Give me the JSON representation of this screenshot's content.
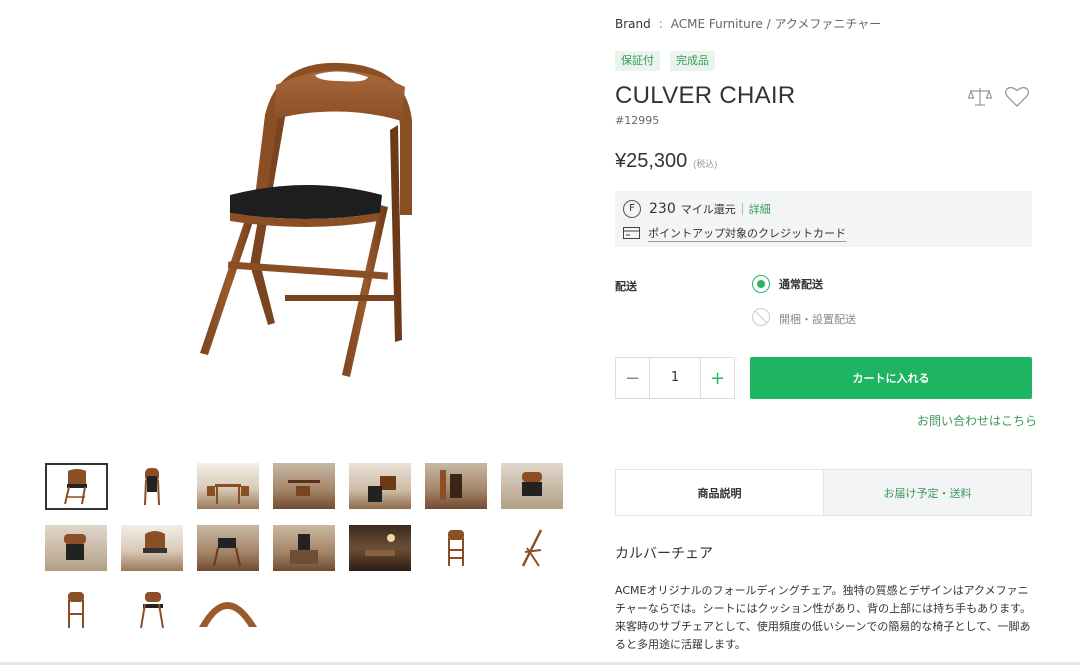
{
  "brand": {
    "label": "Brand",
    "separator": ":",
    "value": "ACME Furniture / アクメファニチャー"
  },
  "badges": [
    "保証付",
    "完成品"
  ],
  "product": {
    "title": "CULVER CHAIR",
    "sku": "#12995",
    "price": "¥25,300",
    "tax_note": "(税込)"
  },
  "icons": {
    "compare": "scale-icon",
    "favorite": "heart-icon",
    "mile": "f-mark-icon",
    "card": "credit-card-icon"
  },
  "miles": {
    "mark": "F",
    "amount": "230",
    "unit": "マイル還元",
    "detail_link": "詳細",
    "card_text": "ポイントアップ対象のクレジットカード"
  },
  "shipping": {
    "label": "配送",
    "options": [
      {
        "label": "通常配送",
        "selected": true
      },
      {
        "label": "開梱・設置配送",
        "selected": false
      }
    ]
  },
  "quantity": {
    "minus": "−",
    "value": "1",
    "plus": "+"
  },
  "cart_button": "カートに入れる",
  "contact_link": "お問い合わせはこちら",
  "tabs": [
    {
      "label": "商品説明",
      "active": true
    },
    {
      "label": "お届け予定・送料",
      "active": false
    }
  ],
  "description": {
    "title": "カルバーチェア",
    "body": "ACMEオリジナルのフォールディングチェア。独特の質感とデザインはアクメファニチャーならでは。シートにはクッション性があり、背の上部には持ち手もあります。来客時のサブチェアとして、使用頻度の低いシーンでの簡易的な椅子として、一脚あると多用途に活躍します。"
  },
  "colors": {
    "accent_green": "#1db561",
    "link_green": "#3a9a5b",
    "badge_bg": "#e8f4ec",
    "wood": "#8a4f25",
    "seat": "#1e1e1e"
  }
}
